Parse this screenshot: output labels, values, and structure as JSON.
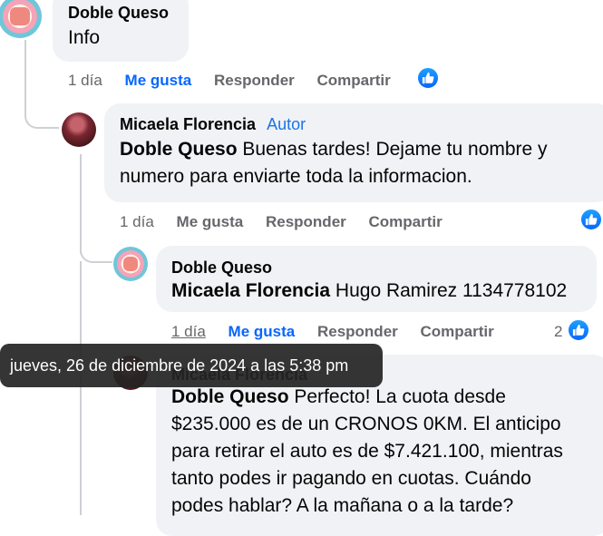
{
  "comments": [
    {
      "author": "Doble Queso",
      "text": "Info",
      "time": "1 día",
      "like_label": "Me gusta",
      "reply_label": "Responder",
      "share_label": "Compartir"
    },
    {
      "author": "Micaela Florencia",
      "badge": "Autor",
      "mention": "Doble Queso",
      "text_line1": "Buenas tardes! Dejame tu nombre y",
      "text_line2": "numero para enviarte toda la informacion.",
      "time": "1 día",
      "like_label": "Me gusta",
      "reply_label": "Responder",
      "share_label": "Compartir"
    },
    {
      "author": "Doble Queso",
      "mention": "Micaela Florencia",
      "text": "Hugo Ramirez 1134778102",
      "time": "1 día",
      "like_label": "Me gusta",
      "reply_label": "Responder",
      "share_label": "Compartir",
      "reaction_count": "2"
    },
    {
      "author": "Micaela Florencia",
      "mention": "Doble Queso",
      "line1": "Perfecto! La cuota desde",
      "line2": "$235.000 es de un CRONOS 0KM. El anticipo",
      "line3": "para retirar el auto es de $7.421.100, mientras",
      "line4": "tanto podes ir pagando en cuotas. Cuándo",
      "line5": "podes hablar? A la mañana o a la tarde?"
    }
  ],
  "tooltip": "jueves, 26 de diciembre de 2024 a las 5:38 pm",
  "colors": {
    "like_blue": "#0866ff",
    "bubble": "#f0f2f5",
    "muted": "#65676b"
  },
  "icons": [
    "like-icon"
  ]
}
